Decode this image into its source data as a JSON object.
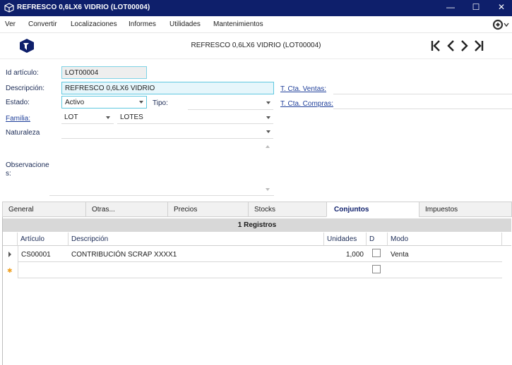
{
  "window": {
    "title": "REFRESCO 0,6LX6 VIDRIO (LOT00004)",
    "minimize": "—",
    "maximize": "☐",
    "close": "✕"
  },
  "menu": {
    "items": [
      "Ver",
      "Convertir",
      "Localizaciones",
      "Informes",
      "Utilidades",
      "Mantenimientos"
    ]
  },
  "header": {
    "title": "REFRESCO 0,6LX6 VIDRIO (LOT00004)"
  },
  "form": {
    "id_label": "Id artículo:",
    "id_value": "LOT00004",
    "desc_label": "Descripción:",
    "desc_value": "REFRESCO 0,6LX6 VIDRIO",
    "estado_label": "Estado:",
    "estado_value": "Activo",
    "tipo_label": "Tipo:",
    "tipo_value": "",
    "familia_label": "Familia:",
    "familia_code": "LOT",
    "familia_name": "LOTES",
    "naturaleza_label": "Naturaleza",
    "naturaleza_value": "",
    "obs_label": "Observacione\ns:",
    "obs_value": "",
    "cta_ventas_label": "T. Cta. Ventas:",
    "cta_ventas_value": "",
    "cta_compras_label": "T. Cta. Compras:",
    "cta_compras_value": ""
  },
  "tabs": [
    "General",
    "Otras...",
    "Precios",
    "Stocks",
    "Conjuntos",
    "Impuestos"
  ],
  "active_tab": "Conjuntos",
  "grid": {
    "caption": "1 Registros",
    "columns": [
      "Artículo",
      "Descripción",
      "Unidades",
      "D",
      "Modo"
    ],
    "rows": [
      {
        "articulo": "CS00001",
        "descripcion": "CONTRIBUCIÓN SCRAP XXXX1",
        "unidades": "1,000",
        "d": false,
        "modo": "Venta"
      }
    ],
    "new_row_marker": "✱"
  },
  "colors": {
    "titlebar": "#0e1f6b",
    "accent_border": "#5fc8e0",
    "link": "#1f3f9a"
  }
}
